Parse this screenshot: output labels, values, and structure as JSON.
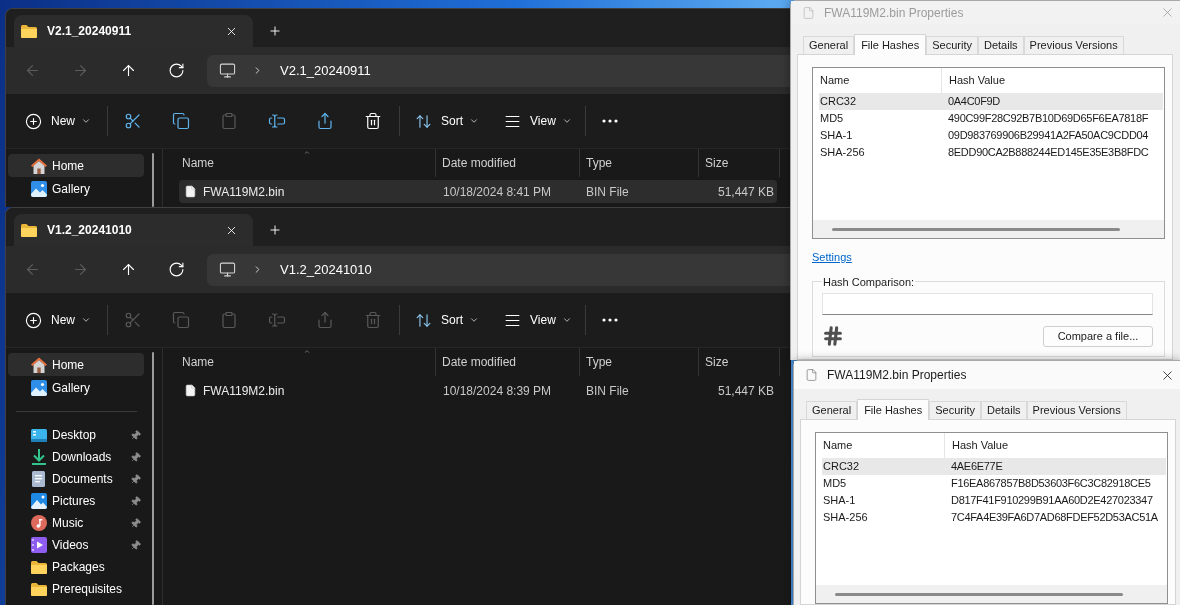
{
  "explorer_windows": [
    {
      "tab": {
        "title": "V2.1_20240911"
      },
      "nav_buttons": [
        {
          "kind": "back",
          "disabled": true
        },
        {
          "kind": "forward",
          "disabled": true
        },
        {
          "kind": "up",
          "disabled": false
        },
        {
          "kind": "refresh",
          "disabled": false
        }
      ],
      "address_bar": {
        "path": "V2.1_20240911"
      },
      "toolbar": {
        "groups": [
          {
            "items": [
              {
                "kind": "new",
                "label": "New",
                "disabled": false
              }
            ]
          },
          {
            "items": [
              {
                "kind": "cut",
                "disabled": false
              },
              {
                "kind": "copy",
                "disabled": false
              },
              {
                "kind": "paste",
                "disabled": true
              },
              {
                "kind": "rename",
                "disabled": false
              },
              {
                "kind": "share",
                "disabled": false
              },
              {
                "kind": "delete",
                "disabled": false
              }
            ]
          },
          {
            "items": [
              {
                "kind": "sort",
                "label": "Sort",
                "disabled": false
              },
              {
                "kind": "view",
                "label": "View",
                "disabled": false
              }
            ]
          },
          {
            "items": [
              {
                "kind": "more",
                "disabled": false
              }
            ]
          }
        ]
      },
      "sidebar": {
        "sections": [
          {
            "items": [
              {
                "kind": "home",
                "label": "Home",
                "selected": true,
                "pinned": false
              },
              {
                "kind": "gallery",
                "label": "Gallery",
                "selected": false,
                "pinned": false
              }
            ]
          }
        ]
      },
      "file_list": {
        "columns": [
          {
            "label": "Name",
            "sorted": true
          },
          {
            "label": "Date modified",
            "sorted": false
          },
          {
            "label": "Type",
            "sorted": false
          },
          {
            "label": "Size",
            "sorted": false
          }
        ],
        "rows": [
          {
            "name": "FWA119M2.bin",
            "date_modified": "10/18/2024 8:41 PM",
            "type": "BIN File",
            "size": "51,447 KB",
            "selected": true
          }
        ]
      }
    },
    {
      "tab": {
        "title": "V1.2_20241010"
      },
      "nav_buttons": [
        {
          "kind": "back",
          "disabled": true
        },
        {
          "kind": "forward",
          "disabled": true
        },
        {
          "kind": "up",
          "disabled": false
        },
        {
          "kind": "refresh",
          "disabled": false
        }
      ],
      "address_bar": {
        "path": "V1.2_20241010"
      },
      "toolbar": {
        "groups": [
          {
            "items": [
              {
                "kind": "new",
                "label": "New",
                "disabled": false
              }
            ]
          },
          {
            "items": [
              {
                "kind": "cut",
                "disabled": true
              },
              {
                "kind": "copy",
                "disabled": true
              },
              {
                "kind": "paste",
                "disabled": true
              },
              {
                "kind": "rename",
                "disabled": true
              },
              {
                "kind": "share",
                "disabled": true
              },
              {
                "kind": "delete",
                "disabled": true
              }
            ]
          },
          {
            "items": [
              {
                "kind": "sort",
                "label": "Sort",
                "disabled": false
              },
              {
                "kind": "view",
                "label": "View",
                "disabled": false
              }
            ]
          },
          {
            "items": [
              {
                "kind": "more",
                "disabled": false
              }
            ]
          }
        ]
      },
      "sidebar": {
        "sections": [
          {
            "items": [
              {
                "kind": "home",
                "label": "Home",
                "selected": true,
                "pinned": false
              },
              {
                "kind": "gallery",
                "label": "Gallery",
                "selected": false,
                "pinned": false
              }
            ]
          },
          {
            "items": [
              {
                "kind": "desktop",
                "label": "Desktop",
                "selected": false,
                "pinned": true
              },
              {
                "kind": "downloads",
                "label": "Downloads",
                "selected": false,
                "pinned": true
              },
              {
                "kind": "documents",
                "label": "Documents",
                "selected": false,
                "pinned": true
              },
              {
                "kind": "pictures",
                "label": "Pictures",
                "selected": false,
                "pinned": true
              },
              {
                "kind": "music",
                "label": "Music",
                "selected": false,
                "pinned": true
              },
              {
                "kind": "videos",
                "label": "Videos",
                "selected": false,
                "pinned": true
              },
              {
                "kind": "folder",
                "label": "Packages",
                "selected": false,
                "pinned": false
              },
              {
                "kind": "folder",
                "label": "Prerequisites",
                "selected": false,
                "pinned": false
              }
            ]
          }
        ]
      },
      "file_list": {
        "columns": [
          {
            "label": "Name",
            "sorted": true
          },
          {
            "label": "Date modified",
            "sorted": false
          },
          {
            "label": "Type",
            "sorted": false
          },
          {
            "label": "Size",
            "sorted": false
          }
        ],
        "rows": [
          {
            "name": "FWA119M2.bin",
            "date_modified": "10/18/2024 8:39 PM",
            "type": "BIN File",
            "size": "51,447 KB",
            "selected": false
          }
        ]
      }
    }
  ],
  "properties_dialogs": [
    {
      "title": "FWA119M2.bin Properties",
      "active": false,
      "tabs": [
        {
          "label": "General",
          "selected": false
        },
        {
          "label": "File Hashes",
          "selected": true
        },
        {
          "label": "Security",
          "selected": false
        },
        {
          "label": "Details",
          "selected": false
        },
        {
          "label": "Previous Versions",
          "selected": false
        }
      ],
      "hash_list": {
        "columns": [
          "Name",
          "Hash Value"
        ],
        "rows": [
          {
            "name": "CRC32",
            "value": "0A4C0F9D",
            "selected": true
          },
          {
            "name": "MD5",
            "value": "490C99F28C92B7B10D69D65F6EA7818F",
            "selected": false
          },
          {
            "name": "SHA-1",
            "value": "09D983769906B29941A2FA50AC9CDD04",
            "selected": false
          },
          {
            "name": "SHA-256",
            "value": "8EDD90CA2B888244ED145E35E3B8FDC",
            "selected": false
          }
        ]
      },
      "settings_link": "Settings",
      "hash_comparison": {
        "label": "Hash Comparison:",
        "button": "Compare a file..."
      }
    },
    {
      "title": "FWA119M2.bin Properties",
      "active": true,
      "tabs": [
        {
          "label": "General",
          "selected": false
        },
        {
          "label": "File Hashes",
          "selected": true
        },
        {
          "label": "Security",
          "selected": false
        },
        {
          "label": "Details",
          "selected": false
        },
        {
          "label": "Previous Versions",
          "selected": false
        }
      ],
      "hash_list": {
        "columns": [
          "Name",
          "Hash Value"
        ],
        "rows": [
          {
            "name": "CRC32",
            "value": "4AE6E77E",
            "selected": true
          },
          {
            "name": "MD5",
            "value": "F16EA867857B8D53603F6C3C82918CE5",
            "selected": false
          },
          {
            "name": "SHA-1",
            "value": "D817F41F910299B91AA60D2E427023347",
            "selected": false
          },
          {
            "name": "SHA-256",
            "value": "7C4FA4E39FA6D7AD68FDEF52D53AC51A",
            "selected": false
          }
        ]
      }
    }
  ]
}
